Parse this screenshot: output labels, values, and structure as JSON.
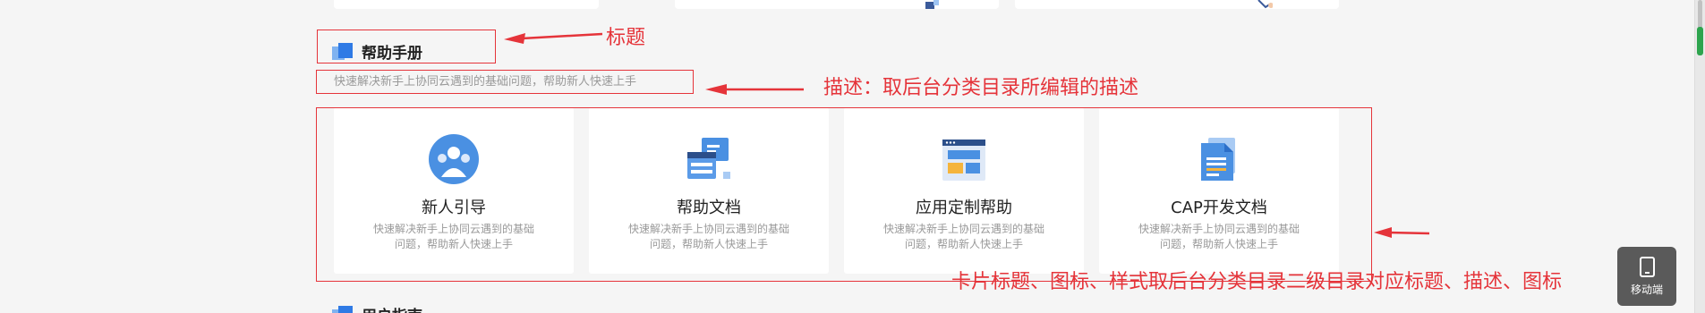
{
  "section": {
    "title": "帮助手册",
    "description": "快速解决新手上协同云遇到的基础问题，帮助新人快速上手"
  },
  "cards": [
    {
      "name": "新人引导",
      "icon": "users-icon",
      "desc": "快速解决新手上协同云遇到的基础问题，帮助新人快速上手"
    },
    {
      "name": "帮助文档",
      "icon": "help-doc-icon",
      "desc": "快速解决新手上协同云遇到的基础问题，帮助新人快速上手"
    },
    {
      "name": "应用定制帮助",
      "icon": "app-window-icon",
      "desc": "快速解决新手上协同云遇到的基础问题，帮助新人快速上手"
    },
    {
      "name": "CAP开发文档",
      "icon": "document-icon",
      "desc": "快速解决新手上协同云遇到的基础问题，帮助新人快速上手"
    }
  ],
  "next_section": {
    "title": "用户指南"
  },
  "annotations": {
    "title_note": "标题",
    "desc_note": "描述：取后台分类目录所编辑的描述",
    "cards_note": "卡片标题、图标、样式取后台分类目录二级目录对应标题、描述、图标",
    "color": "#e5343a"
  },
  "mobile_button": {
    "label": "移动端",
    "icon": "tablet-icon"
  },
  "colors": {
    "accent": "#4a90e2",
    "page_bg": "#f5f5f5"
  }
}
